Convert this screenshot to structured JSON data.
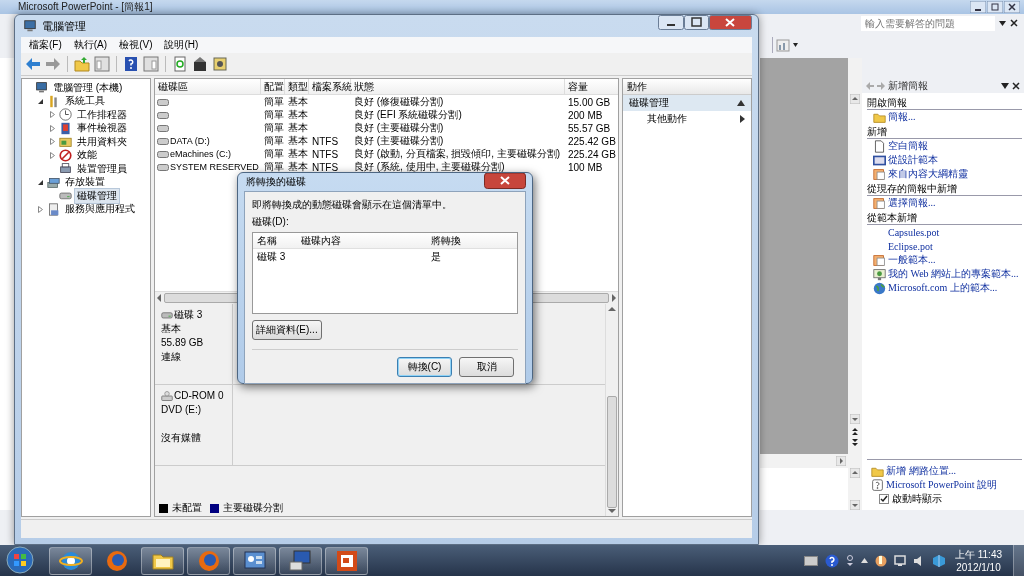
{
  "ppt": {
    "title": "Microsoft PowerPoint - [簡報1]",
    "help_field": {
      "placeholder": "輸入需要解答的問題"
    },
    "task_pane": {
      "title": "新增簡報",
      "sections": [
        {
          "heading": "開啟簡報",
          "items": [
            {
              "label": "簡報...",
              "kind": "folder"
            }
          ]
        },
        {
          "heading": "新增",
          "items": [
            {
              "label": "空白簡報",
              "kind": "page"
            },
            {
              "label": "從設計範本",
              "kind": "design"
            },
            {
              "label": "來自內容大綱精靈",
              "kind": "wizard"
            }
          ]
        },
        {
          "heading": "從現存的簡報中新增",
          "items": [
            {
              "label": "選擇簡報...",
              "kind": "wizard"
            }
          ]
        },
        {
          "heading": "從範本新增",
          "items": [
            {
              "label": "Capsules.pot",
              "kind": "file"
            },
            {
              "label": "Eclipse.pot",
              "kind": "file"
            },
            {
              "label": "一般範本...",
              "kind": "wizard"
            },
            {
              "label": "我的 Web 網站上的專案範本...",
              "kind": "web"
            },
            {
              "label": "Microsoft.com 上的範本...",
              "kind": "globe"
            }
          ]
        }
      ],
      "links": [
        {
          "label": "新增 網路位置...",
          "kind": "folder"
        },
        {
          "label": "Microsoft PowerPoint 說明",
          "kind": "help"
        }
      ],
      "startup": {
        "label": "啟動時顯示",
        "checked": true
      }
    }
  },
  "mmc": {
    "title": "電腦管理",
    "menu": [
      "檔案(F)",
      "執行(A)",
      "檢視(V)",
      "說明(H)"
    ],
    "tree": [
      {
        "label": "電腦管理 (本機)",
        "kind": "computer",
        "selected": false,
        "children": [
          {
            "label": "系統工具",
            "kind": "tools",
            "expanded": true,
            "selected": false,
            "children": [
              {
                "label": "工作排程器",
                "kind": "clock",
                "expanded": false,
                "selected": false
              },
              {
                "label": "事件檢視器",
                "kind": "eventlog",
                "expanded": false,
                "selected": false
              },
              {
                "label": "共用資料夾",
                "kind": "share",
                "expanded": false,
                "selected": false
              },
              {
                "label": "效能",
                "kind": "perf",
                "expanded": false,
                "selected": false
              },
              {
                "label": "裝置管理員",
                "kind": "devices",
                "selected": false
              }
            ]
          },
          {
            "label": "存放裝置",
            "kind": "storage",
            "expanded": true,
            "selected": false,
            "children": [
              {
                "label": "磁碟管理",
                "kind": "disk",
                "selected": true
              }
            ]
          },
          {
            "label": "服務與應用程式",
            "kind": "services",
            "expanded": false,
            "selected": false
          }
        ]
      }
    ],
    "volumes": {
      "columns": [
        "磁碟區",
        "配置",
        "類型",
        "檔案系統",
        "狀態",
        "容量"
      ],
      "rows": [
        {
          "layout": "簡單",
          "type": "基本",
          "status": "良好 (修復磁碟分割)",
          "capacity": "15.00 GB"
        },
        {
          "layout": "簡單",
          "type": "基本",
          "status": "良好 (EFI 系統磁碟分割)",
          "capacity": "200 MB"
        },
        {
          "layout": "簡單",
          "type": "基本",
          "status": "良好 (主要磁碟分割)",
          "capacity": "55.57 GB"
        },
        {
          "name": "DATA (D:)",
          "layout": "簡單",
          "type": "基本",
          "fs": "NTFS",
          "status": "良好 (主要磁碟分割)",
          "capacity": "225.42 GB"
        },
        {
          "name": "eMachines (C:)",
          "layout": "簡單",
          "type": "基本",
          "fs": "NTFS",
          "status": "良好 (啟動, 分頁檔案, 損毀傾印, 主要磁碟分割)",
          "capacity": "225.24 GB"
        },
        {
          "name": "SYSTEM RESERVED",
          "layout": "簡單",
          "type": "基本",
          "fs": "NTFS",
          "status": "良好 (系統, 使用中, 主要磁碟分割)",
          "capacity": "100 MB"
        }
      ]
    },
    "disks": [
      {
        "kind": "disk",
        "name": "磁碟 3",
        "type": "基本",
        "size": "55.89 GB",
        "status": "連線"
      },
      {
        "kind": "cdrom",
        "name": "CD-ROM 0",
        "type": "DVD (E:)",
        "status": "沒有媒體"
      }
    ],
    "legend": [
      {
        "label": "未配置",
        "color": "#000000"
      },
      {
        "label": "主要磁碟分割",
        "color": "#000080"
      }
    ],
    "actions": {
      "title": "動作",
      "group": "磁碟管理",
      "items": [
        "其他動作"
      ]
    }
  },
  "dialog": {
    "title": "將轉換的磁碟",
    "message": "即將轉換成的動態磁碟會顯示在這個清單中。",
    "list_label": "磁碟(D):",
    "columns": [
      "名稱",
      "磁碟內容",
      "將轉換"
    ],
    "rows": [
      {
        "name": "磁碟 3",
        "convert": "是"
      }
    ],
    "details_button": "詳細資料(E)...",
    "buttons": [
      {
        "label": "轉換(C)",
        "default": true
      },
      {
        "label": "取消",
        "default": false
      }
    ]
  },
  "taskbar": {
    "apps": [
      {
        "kind": "ie",
        "open": true
      },
      {
        "kind": "firefox",
        "open": false
      },
      {
        "kind": "explorer",
        "open": true
      },
      {
        "kind": "firefox",
        "open": true
      },
      {
        "kind": "control",
        "open": true
      },
      {
        "kind": "network",
        "open": true
      },
      {
        "kind": "powerpoint",
        "open": true
      }
    ],
    "clock": {
      "time": "上午 11:43",
      "date": "2012/1/10"
    }
  }
}
